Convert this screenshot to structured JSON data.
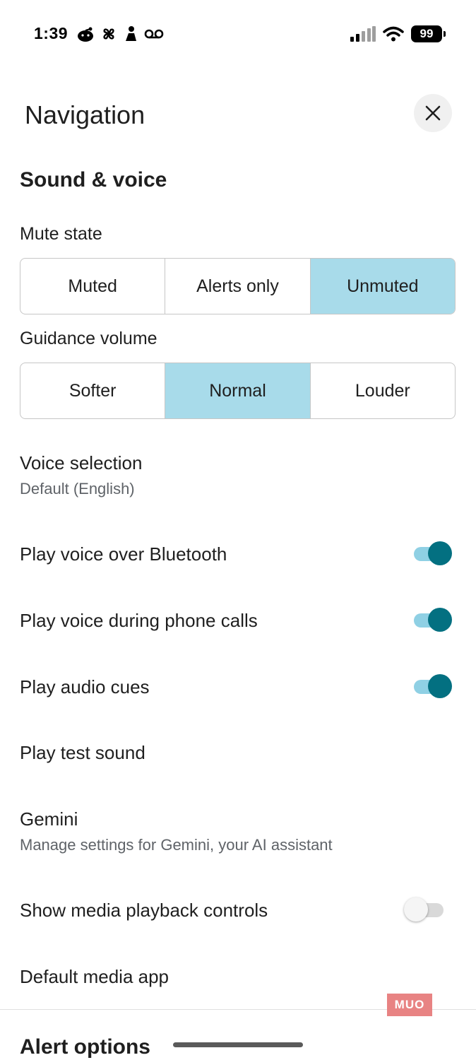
{
  "status_bar": {
    "time": "1:39",
    "battery": "99"
  },
  "header": {
    "title": "Navigation",
    "close_icon": "close-icon"
  },
  "sound_voice": {
    "title": "Sound & voice",
    "mute_state": {
      "label": "Mute state",
      "options": [
        "Muted",
        "Alerts only",
        "Unmuted"
      ],
      "selected": "Unmuted"
    },
    "guidance_volume": {
      "label": "Guidance volume",
      "options": [
        "Softer",
        "Normal",
        "Louder"
      ],
      "selected": "Normal"
    },
    "voice_selection": {
      "title": "Voice selection",
      "value": "Default (English)"
    },
    "play_voice_bluetooth": {
      "title": "Play voice over Bluetooth",
      "enabled": true
    },
    "play_voice_calls": {
      "title": "Play voice during phone calls",
      "enabled": true
    },
    "play_audio_cues": {
      "title": "Play audio cues",
      "enabled": true
    },
    "play_test_sound": {
      "title": "Play test sound"
    },
    "gemini": {
      "title": "Gemini",
      "subtitle": "Manage settings for Gemini, your AI assistant"
    },
    "media_playback": {
      "title": "Show media playback controls",
      "enabled": false
    },
    "default_media_app": {
      "title": "Default media app"
    }
  },
  "alert_options": {
    "title": "Alert options"
  },
  "watermark": "MUO",
  "colors": {
    "accent": "#037081",
    "selected_segment": "#a8dbea",
    "toggle_track_on": "#8fd0e4"
  }
}
